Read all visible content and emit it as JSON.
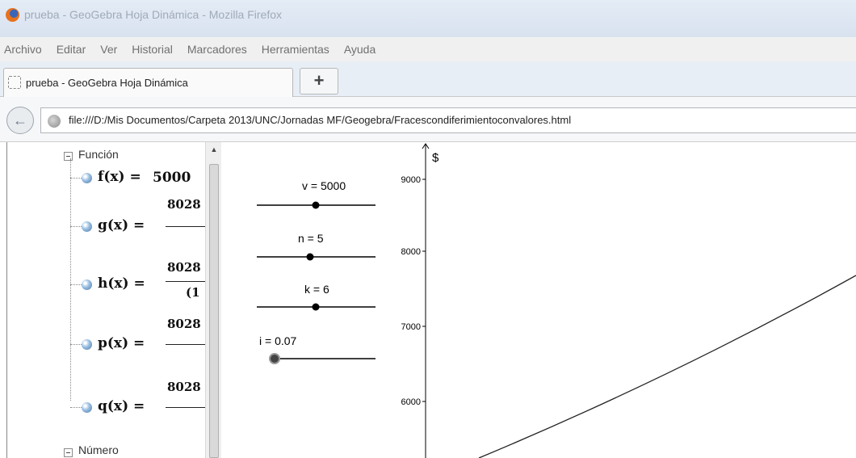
{
  "window": {
    "title": "prueba - GeoGebra Hoja Dinámica - Mozilla Firefox"
  },
  "menu": [
    "Archivo",
    "Editar",
    "Ver",
    "Historial",
    "Marcadores",
    "Herramientas",
    "Ayuda"
  ],
  "tabs": [
    {
      "label": "prueba - GeoGebra Hoja Dinámica",
      "active": true
    }
  ],
  "new_tab_label": "+",
  "address": {
    "url": "file:///D:/Mis Documentos/Carpeta 2013/UNC/Jornadas MF/Geogebra/Fracescondiferimientoconvalores.html"
  },
  "algebra": {
    "funcion_header": "Función",
    "numero_header": "Número",
    "functions": [
      {
        "name": "f(x) =",
        "expr": "5000"
      },
      {
        "name": "g(x) =",
        "expr": "8028"
      },
      {
        "name": "h(x) =",
        "expr": "8028",
        "expr_bottom": "(1"
      },
      {
        "name": "p(x) =",
        "expr": "8028"
      },
      {
        "name": "q(x) =",
        "expr": "8028"
      }
    ]
  },
  "graphics": {
    "axis_unit": "$",
    "y_ticks": [
      "9000",
      "8000",
      "7000",
      "6000"
    ],
    "sliders": [
      {
        "label": "v = 5000"
      },
      {
        "label": "n = 5"
      },
      {
        "label": "k = 6"
      },
      {
        "label": "i = 0.07"
      }
    ]
  },
  "colors": {
    "titlebar": "#dce5f1",
    "title_text": "#a0aab8",
    "menu_text": "#707070"
  }
}
